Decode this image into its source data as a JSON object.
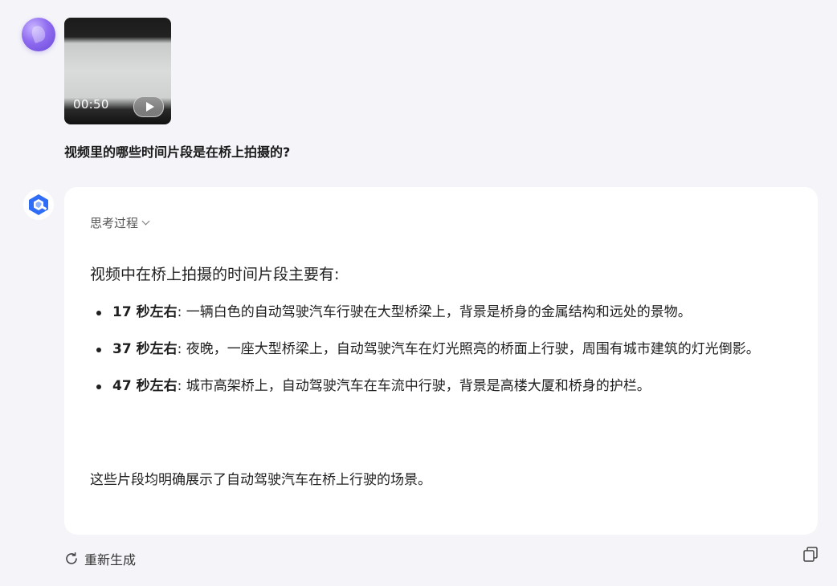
{
  "user_message": {
    "video": {
      "duration": "00:50",
      "play_icon": "play-icon"
    },
    "question": "视频里的哪些时间片段是在桥上拍摄的?"
  },
  "assistant_message": {
    "thinking_label": "思考过程",
    "intro": "视频中在桥上拍摄的时间片段主要有:",
    "items": [
      {
        "time": "17 秒左右",
        "description": "一辆白色的自动驾驶汽车行驶在大型桥梁上，背景是桥身的金属结构和远处的景物。"
      },
      {
        "time": "37 秒左右",
        "description": "夜晚，一座大型桥梁上，自动驾驶汽车在灯光照亮的桥面上行驶，周围有城市建筑的灯光倒影。"
      },
      {
        "time": "47 秒左右",
        "description": "城市高架桥上，自动驾驶汽车在车流中行驶，背景是高楼大厦和桥身的护栏。"
      }
    ],
    "separator": ":",
    "summary": "这些片段均明确展示了自动驾驶汽车在桥上行驶的场景。"
  },
  "actions": {
    "regenerate_label": "重新生成",
    "regenerate_icon": "refresh-icon",
    "copy_icon": "copy-icon"
  },
  "colors": {
    "background": "#f4f4f9",
    "card": "#ffffff",
    "assistant_logo": "#2f6df6",
    "user_avatar": "#8f6cf0"
  }
}
